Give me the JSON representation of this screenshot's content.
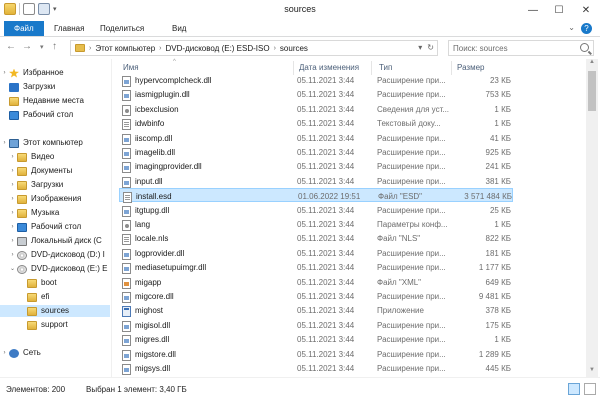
{
  "window": {
    "title": "sources",
    "min": "—",
    "max": "☐",
    "close": "✕"
  },
  "ribbon": {
    "tabs": [
      "Файл",
      "Главная",
      "Поделиться",
      "Вид"
    ],
    "collapse": "⌄",
    "help": "?"
  },
  "address": {
    "path": [
      "Этот компьютер",
      "DVD-дисковод (E:) ESD-ISO",
      "sources"
    ],
    "search_placeholder": "Поиск: sources"
  },
  "sidebar": {
    "items": [
      {
        "label": "Избранное",
        "icon": "star-icon"
      },
      {
        "label": "Загрузки",
        "icon": "downloads-folder-icon"
      },
      {
        "label": "Недавние места",
        "icon": "recent-places-icon"
      },
      {
        "label": "Рабочий стол",
        "icon": "desktop-icon"
      },
      {
        "label": "Этот компьютер",
        "icon": "computer-icon"
      },
      {
        "label": "Видео",
        "icon": "folder-icon"
      },
      {
        "label": "Документы",
        "icon": "folder-icon"
      },
      {
        "label": "Загрузки",
        "icon": "folder-icon"
      },
      {
        "label": "Изображения",
        "icon": "folder-icon"
      },
      {
        "label": "Музыка",
        "icon": "folder-icon"
      },
      {
        "label": "Рабочий стол",
        "icon": "desktop-icon"
      },
      {
        "label": "Локальный диск (C",
        "icon": "drive-icon"
      },
      {
        "label": "DVD-дисковод (D:) I",
        "icon": "dvd-icon"
      },
      {
        "label": "DVD-дисковод (E:) E",
        "icon": "dvd-icon"
      },
      {
        "label": "boot",
        "icon": "folder-icon"
      },
      {
        "label": "efi",
        "icon": "folder-icon"
      },
      {
        "label": "sources",
        "icon": "folder-icon"
      },
      {
        "label": "support",
        "icon": "folder-icon"
      },
      {
        "label": "Сеть",
        "icon": "network-icon"
      }
    ]
  },
  "columns": {
    "name": "Имя",
    "date": "Дата изменения",
    "type": "Тип",
    "size": "Размер"
  },
  "files": [
    {
      "name": "hypervcomplcheck.dll",
      "date": "05.11.2021 3:44",
      "type": "Расширение при...",
      "size": "23 КБ",
      "icon": "dll"
    },
    {
      "name": "iasmigplugin.dll",
      "date": "05.11.2021 3:44",
      "type": "Расширение при...",
      "size": "753 КБ",
      "icon": "dll"
    },
    {
      "name": "icbexclusion",
      "date": "05.11.2021 3:44",
      "type": "Сведения для уст...",
      "size": "1 КБ",
      "icon": "cfg"
    },
    {
      "name": "idwbinfo",
      "date": "05.11.2021 3:44",
      "type": "Текстовый доку...",
      "size": "1 КБ",
      "icon": "txt"
    },
    {
      "name": "iiscomp.dll",
      "date": "05.11.2021 3:44",
      "type": "Расширение при...",
      "size": "41 КБ",
      "icon": "dll"
    },
    {
      "name": "imagelib.dll",
      "date": "05.11.2021 3:44",
      "type": "Расширение при...",
      "size": "925 КБ",
      "icon": "dll"
    },
    {
      "name": "imagingprovider.dll",
      "date": "05.11.2021 3:44",
      "type": "Расширение при...",
      "size": "241 КБ",
      "icon": "dll"
    },
    {
      "name": "input.dll",
      "date": "05.11.2021 3:44",
      "type": "Расширение при...",
      "size": "381 КБ",
      "icon": "dll"
    },
    {
      "name": "install.esd",
      "date": "01.06.2022 19:51",
      "type": "Файл \"ESD\"",
      "size": "3 571 484 КБ",
      "icon": "txt",
      "selected": true
    },
    {
      "name": "itgtupg.dll",
      "date": "05.11.2021 3:44",
      "type": "Расширение при...",
      "size": "25 КБ",
      "icon": "dll"
    },
    {
      "name": "lang",
      "date": "05.11.2021 3:44",
      "type": "Параметры конф...",
      "size": "1 КБ",
      "icon": "cfg"
    },
    {
      "name": "locale.nls",
      "date": "05.11.2021 3:44",
      "type": "Файл \"NLS\"",
      "size": "822 КБ",
      "icon": "txt"
    },
    {
      "name": "logprovider.dll",
      "date": "05.11.2021 3:44",
      "type": "Расширение при...",
      "size": "181 КБ",
      "icon": "dll"
    },
    {
      "name": "mediasetupuimgr.dll",
      "date": "05.11.2021 3:44",
      "type": "Расширение при...",
      "size": "1 177 КБ",
      "icon": "dll"
    },
    {
      "name": "migapp",
      "date": "05.11.2021 3:44",
      "type": "Файл \"XML\"",
      "size": "649 КБ",
      "icon": "xml"
    },
    {
      "name": "migcore.dll",
      "date": "05.11.2021 3:44",
      "type": "Расширение при...",
      "size": "9 481 КБ",
      "icon": "dll"
    },
    {
      "name": "mighost",
      "date": "05.11.2021 3:44",
      "type": "Приложение",
      "size": "378 КБ",
      "icon": "exe"
    },
    {
      "name": "migisol.dll",
      "date": "05.11.2021 3:44",
      "type": "Расширение при...",
      "size": "175 КБ",
      "icon": "dll"
    },
    {
      "name": "migres.dll",
      "date": "05.11.2021 3:44",
      "type": "Расширение при...",
      "size": "1 КБ",
      "icon": "dll"
    },
    {
      "name": "migstore.dll",
      "date": "05.11.2021 3:44",
      "type": "Расширение при...",
      "size": "1 289 КБ",
      "icon": "dll"
    },
    {
      "name": "migsys.dll",
      "date": "05.11.2021 3:44",
      "type": "Расширение при...",
      "size": "445 КБ",
      "icon": "dll"
    }
  ],
  "status": {
    "count": "Элементов: 200",
    "selection": "Выбран 1 элемент: 3,40 ГБ"
  }
}
